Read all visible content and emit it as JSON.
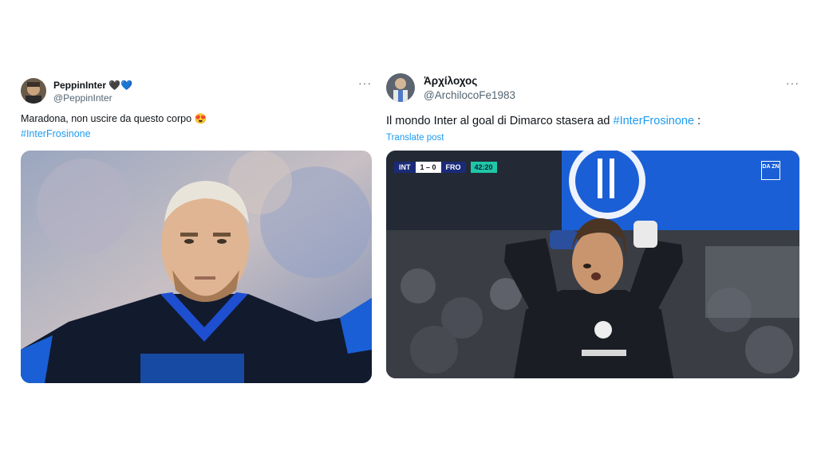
{
  "tweet1": {
    "display_name": "PeppinInter",
    "name_emoji": "🖤💙",
    "handle": "@PeppinInter",
    "more": "···",
    "text": "Maradona, non uscire da questo corpo 😍",
    "hashtag": "#InterFrosinone"
  },
  "tweet2": {
    "display_name": "Ἀρχίλοχος",
    "handle": "@ArchilocoFe1983",
    "more": "···",
    "text": "Il mondo Inter al goal di Dimarco stasera ad ",
    "hashtag": "#InterFrosinone",
    "text_suffix": " :",
    "translate": "Translate post",
    "scorebug": {
      "home": "INT",
      "score": "1 – 0",
      "away": "FRO",
      "time": "42:20"
    },
    "broadcaster": "DA ZN"
  },
  "colors": {
    "link": "#1d9bf0",
    "inter_blue": "#1a5fd6",
    "dazn_teal": "#20c7a6"
  }
}
